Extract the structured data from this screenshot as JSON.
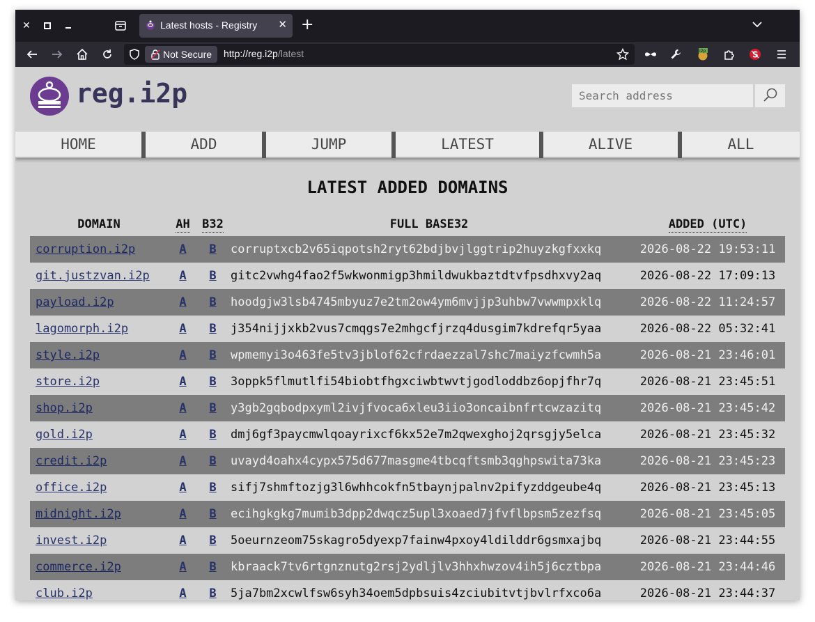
{
  "browser": {
    "tab_title": "Latest hosts - Registry",
    "security_label": "Not Secure",
    "url_scheme_host": "http://reg.i2p",
    "url_path": "/latest"
  },
  "site": {
    "name": "reg.i2p",
    "search_placeholder": "Search address"
  },
  "nav": [
    "HOME",
    "ADD",
    "JUMP",
    "LATEST",
    "ALIVE",
    "ALL"
  ],
  "main": {
    "heading": "LATEST ADDED DOMAINS",
    "columns": [
      "DOMAIN",
      "AH",
      "B32",
      "FULL BASE32",
      "ADDED (UTC)"
    ],
    "rows": [
      {
        "domain": "corruption.i2p",
        "ah": "A",
        "b32": "B",
        "full": "corruptxcb2v65iqpotsh2ryt62bdjbvjlggtrip2huyzkgfxxkq",
        "added": "2026-08-22 19:53:11"
      },
      {
        "domain": "git.justzvan.i2p",
        "ah": "A",
        "b32": "B",
        "full": "gitc2vwhg4fao2f5wkwonmigp3hmildwukbaztdtvfpsdhxvy2aq",
        "added": "2026-08-22 17:09:13"
      },
      {
        "domain": "payload.i2p",
        "ah": "A",
        "b32": "B",
        "full": "hoodgjw3lsb4745mbyuz7e2tm2ow4ym6mvjjp3uhbw7vwwmpxklq",
        "added": "2026-08-22 11:24:57"
      },
      {
        "domain": "lagomorph.i2p",
        "ah": "A",
        "b32": "B",
        "full": "j354nijjxkb2vus7cmqgs7e2mhgcfjrzq4dusgim7kdrefqr5yaa",
        "added": "2026-08-22 05:32:41"
      },
      {
        "domain": "style.i2p",
        "ah": "A",
        "b32": "B",
        "full": "wpmemyi3o463fe5tv3jblof62cfrdaezzal7shc7maiyzfcwmh5a",
        "added": "2026-08-21 23:46:01"
      },
      {
        "domain": "store.i2p",
        "ah": "A",
        "b32": "B",
        "full": "3oppk5flmutlfi54biobtfhgxciwbtwvtjgodloddbz6opjfhr7q",
        "added": "2026-08-21 23:45:51"
      },
      {
        "domain": "shop.i2p",
        "ah": "A",
        "b32": "B",
        "full": "y3gb2gqbodpxyml2ivjfvoca6xleu3iio3oncaibnfrtcwzazitq",
        "added": "2026-08-21 23:45:42"
      },
      {
        "domain": "gold.i2p",
        "ah": "A",
        "b32": "B",
        "full": "dmj6gf3paycmwlqoayrixcf6kx52e7m2qwexghoj2qrsgjy5elca",
        "added": "2026-08-21 23:45:32"
      },
      {
        "domain": "credit.i2p",
        "ah": "A",
        "b32": "B",
        "full": "uvayd4oahx4cypx575d677masgme4tbcqftsmb3qghpswita73ka",
        "added": "2026-08-21 23:45:23"
      },
      {
        "domain": "office.i2p",
        "ah": "A",
        "b32": "B",
        "full": "sifj7shmftozjg3l6whhcokfn5tbaynjpalnv2pifyzddgeube4q",
        "added": "2026-08-21 23:45:13"
      },
      {
        "domain": "midnight.i2p",
        "ah": "A",
        "b32": "B",
        "full": "ecihgkgkg7mumib3dpp2dwqcz5upl3xoaed7jfvflbpsm5zezfsq",
        "added": "2026-08-21 23:45:05"
      },
      {
        "domain": "invest.i2p",
        "ah": "A",
        "b32": "B",
        "full": "5oeurnzeom75skagro5dyexp7fainw4pxoy4ldilddr6gsmxajbq",
        "added": "2026-08-21 23:44:55"
      },
      {
        "domain": "commerce.i2p",
        "ah": "A",
        "b32": "B",
        "full": "kbraack7tv6rtgnznutg2rsj2ydljlv3hhxhwzov4ih5j6cztbpa",
        "added": "2026-08-21 23:44:46"
      },
      {
        "domain": "club.i2p",
        "ah": "A",
        "b32": "B",
        "full": "5ja7bm2xcwlfsw6syh34oem5dpbsuis4zciubitvtjbvlrfxco6a",
        "added": "2026-08-21 23:44:37"
      }
    ]
  }
}
